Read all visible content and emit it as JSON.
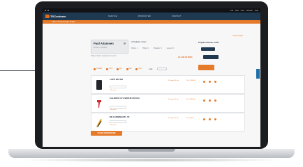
{
  "window": {
    "os_menu": [
      "File",
      "Edit",
      "View",
      "Window",
      "Help"
    ]
  },
  "app": {
    "logo_text": "ITSConlearn",
    "nav": [
      "SERVICE",
      "PRODUKTER",
      "KONTAKT"
    ],
    "breadcrumb": "Hjem / Kundeoversigt / Projekt",
    "top_link": "+ Opret projekt"
  },
  "customer": {
    "name": "Paul Adamsen",
    "subtitle": "Kunde nr. 100234"
  },
  "summary": {
    "product_count": "3 Produkter i listen",
    "project_number": "Projekt nummer: 1234",
    "stats": [
      "Ordrer: 1",
      "Tilbud: 2",
      "Projekter: 3",
      "Leveret: 0"
    ],
    "hint": "Tilføj produkter til projektet herunder",
    "total": "21.240,00 DKK"
  },
  "toolbar": {
    "tools": [
      "Opdater",
      "Print",
      "Del",
      "Slet",
      "Gem"
    ],
    "mode": "Liste"
  },
  "items": [
    {
      "name": "LAPP 900 KB",
      "note": "Tilføj note",
      "avail": "På lager 24 stk.",
      "price": "Pris 1.200,00"
    },
    {
      "name": "CALDRIX 18 V SKRUE 800 KG",
      "note": "Tilføj note",
      "avail": "På lager 12 stk.",
      "price": "Pris 3.850,00"
    },
    {
      "name": "MF LEDNINGSTL 55",
      "note": "Tilføj note",
      "avail": "På lager 40 stk.",
      "price": "Pris 640,00"
    }
  ],
  "add_button": "TILFØJ PRODUKTER",
  "colors": {
    "nav_bg": "#1f3950",
    "accent": "#e57b2a",
    "side_tab": "#1f6fa8"
  }
}
